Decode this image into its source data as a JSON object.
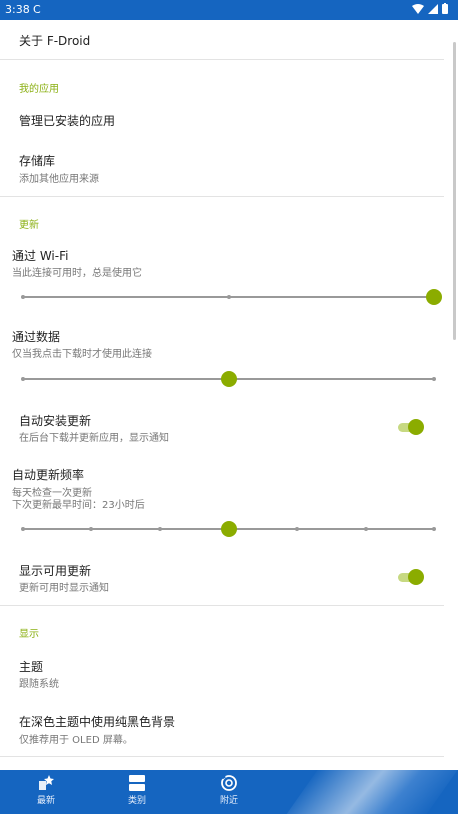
{
  "status_bar": {
    "time": "3:38",
    "sync_glyph": "C"
  },
  "rows": {
    "about": "关于 F-Droid",
    "cat_my_apps": "我的应用",
    "manage_installed": "管理已安装的应用",
    "repos_title": "存储库",
    "repos_sub": "添加其他应用来源",
    "cat_updates": "更新",
    "wifi_title": "通过 Wi-Fi",
    "wifi_sub": "当此连接可用时，总是使用它",
    "data_title": "通过数据",
    "data_sub": "仅当我点击下载时才使用此连接",
    "auto_install_title": "自动安装更新",
    "auto_install_sub": "在后台下载并更新应用，显示通知",
    "freq_title": "自动更新频率",
    "freq_sub1": "每天检查一次更新",
    "freq_sub2": "下次更新最早时间：23小时后",
    "show_updates_title": "显示可用更新",
    "show_updates_sub": "更新可用时显示通知",
    "cat_display": "显示",
    "theme_title": "主题",
    "theme_sub": "跟随系统",
    "black_title": "在深色主题中使用纯黑色背景",
    "black_sub": "仅推荐用于 OLED 屏幕。"
  },
  "sliders": {
    "wifi": {
      "position": 1.0,
      "stops": 3
    },
    "data": {
      "position": 0.5,
      "stops": 3
    },
    "frequency": {
      "position": 0.5,
      "stops": 7
    }
  },
  "switches": {
    "auto_install": true,
    "show_updates": true
  },
  "bottom_nav": {
    "latest": "最新",
    "categories": "类别",
    "nearby": "附近"
  },
  "colors": {
    "primary": "#1565c0",
    "accent": "#8bac00",
    "category_text": "#8bb014"
  }
}
